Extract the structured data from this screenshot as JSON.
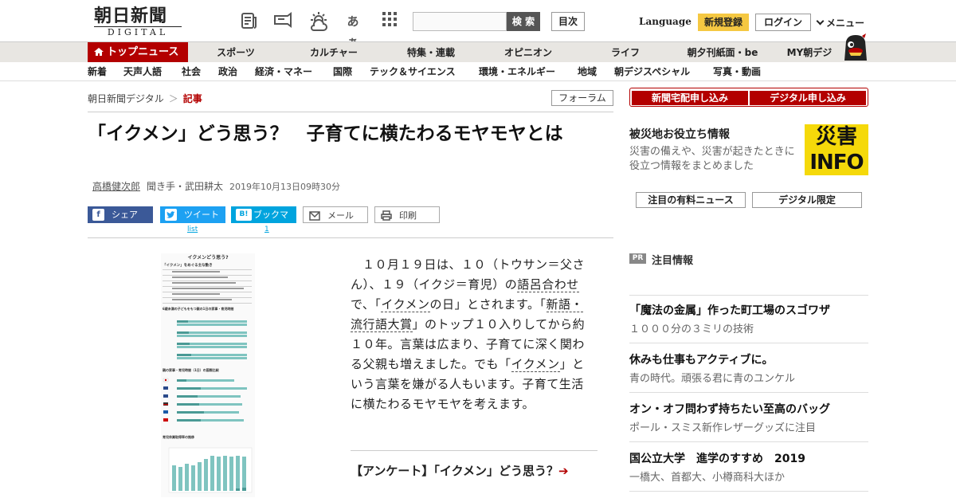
{
  "header": {
    "logo_jp": "朝日新聞",
    "logo_en": "DIGITAL",
    "font_size_label": "あぁ",
    "search_button": "検 索",
    "mokuji": "目次",
    "language": "Language",
    "register": "新規登録",
    "login": "ログイン",
    "menu": "メニュー"
  },
  "nav_primary": [
    {
      "label": "トップニュース"
    },
    {
      "label": "スポーツ"
    },
    {
      "label": "カルチャー"
    },
    {
      "label": "特集・連載"
    },
    {
      "label": "オピニオン"
    },
    {
      "label": "ライフ"
    },
    {
      "label": "朝夕刊紙面・be"
    },
    {
      "label": "MY朝デジ"
    }
  ],
  "nav_secondary": [
    {
      "label": "新着"
    },
    {
      "label": "天声人語"
    },
    {
      "label": "社会"
    },
    {
      "label": "政治"
    },
    {
      "label": "経済・マネー"
    },
    {
      "label": "国際"
    },
    {
      "label": "テック＆サイエンス"
    },
    {
      "label": "環境・エネルギー"
    },
    {
      "label": "地域"
    },
    {
      "label": "朝デジスペシャル"
    },
    {
      "label": "写真・動画"
    }
  ],
  "breadcrumb": {
    "root": "朝日新聞デジタル",
    "sep": "＞",
    "current": "記事"
  },
  "forum": "フォーラム",
  "article": {
    "title": "「イクメン」どう思う？　子育てに横たわるモヤモヤとは",
    "author": "高橋健次郎",
    "interviewer": "聞き手・武田耕太",
    "date": "2019年10月13日09時30分",
    "body_1": "１０月１９日は、１０（トウサン＝父さん）、１９（イクジ＝育児）の",
    "link_goro": "語呂合わせ",
    "body_2": "で、「",
    "link_ikumen1": "イクメン",
    "body_3": "の日」とされます。「",
    "link_ryukogo": "新語・流行語大賞",
    "body_4": "」のトップ１０入りしてから約１０年。言葉は広まり、子育てに深く関わる父親も増えました。でも「",
    "link_ikumen2": "イクメン",
    "body_5": "」という言葉を嫌がる人もいます。子育て生活に横たわるモヤモヤを考えます。",
    "enquete": "【アンケート】「イクメン」どう思う？",
    "enquete_arrow": "➔"
  },
  "share": {
    "facebook": "シェア",
    "twitter": "ツイート",
    "hatena": "ブックマーク",
    "hatena_icon": "B!",
    "mail": "メール",
    "print": "印刷",
    "twitter_count": "list",
    "hatena_count": "1"
  },
  "figure": {
    "title": "イクメンどう思う?",
    "heading1": "「イクメン」をめぐる主な動き",
    "heading2": "6歳未満の子どもをもつ親の1日の家事・育児時間",
    "heading3": "親の家事・育児時間（1日）の国際比較",
    "heading4": "育児休業取得率の推移"
  },
  "sidebar": {
    "btn_newspaper": "新聞宅配申し込み",
    "btn_digital": "デジタル申し込み",
    "saigai_title": "被災地お役立ち情報",
    "saigai_desc": "災害の備えや、災害が起きたときに役立つ情報をまとめました",
    "saigai_img_top": "災害",
    "saigai_img_bottom": "INFO",
    "btn_paid_news": "注目の有料ニュース",
    "btn_digital_only": "デジタル限定",
    "pr": "PR",
    "chumoku": "注目情報",
    "ads": [
      {
        "title": "「魔法の金属」作った町工場のスゴワザ",
        "desc": "１０００分の３ミリの技術"
      },
      {
        "title": "休みも仕事もアクティブに。",
        "desc": "青の時代。頑張る君に青のユンケル"
      },
      {
        "title": "オン・オフ問わず持ちたい至高のバッグ",
        "desc": "ポール・スミス新作レザーグッズに注目"
      },
      {
        "title": "国公立大学　進学のすすめ　2019",
        "desc": "一橋大、首都大、小樽商科大ほか"
      }
    ]
  },
  "colors": {
    "brand_red": "#b30000",
    "nav_bg": "#e8e6e2",
    "accent_yellow": "#f5c842"
  }
}
